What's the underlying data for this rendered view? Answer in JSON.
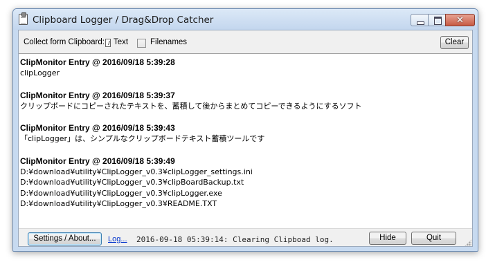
{
  "window": {
    "title": "Clipboard Logger / Drag&Drop Catcher",
    "controls": {
      "close_glyph": "✕"
    }
  },
  "toolbar": {
    "collect_label": "Collect form Clipboard:",
    "option_text_label": "Text",
    "option_filenames_label": "Filenames",
    "option_filenames_checked": false,
    "clear_label": "Clear"
  },
  "log": {
    "entries": [
      {
        "header": "ClipMonitor Entry @ 2016/09/18 5:39:28",
        "lines": [
          "clipLogger"
        ]
      },
      {
        "header": "ClipMonitor Entry @ 2016/09/18 5:39:37",
        "lines": [
          "クリップボードにコピーされたテキストを、蓄積して後からまとめてコピーできるようにするソフト"
        ]
      },
      {
        "header": "ClipMonitor Entry @ 2016/09/18 5:39:43",
        "lines": [
          "「clipLogger」は、シンプルなクリップボードテキスト蓄積ツールです"
        ]
      },
      {
        "header": "ClipMonitor Entry @ 2016/09/18 5:39:49",
        "lines": [
          "D:¥download¥utility¥ClipLogger_v0.3¥clipLogger_settings.ini",
          "D:¥download¥utility¥ClipLogger_v0.3¥clipBoardBackup.txt",
          "D:¥download¥utility¥ClipLogger_v0.3¥clipLogger.exe",
          "D:¥download¥utility¥ClipLogger_v0.3¥README.TXT"
        ]
      }
    ]
  },
  "statusbar": {
    "settings_label": "Settings / About...",
    "log_link": "Log...",
    "status_text": "2016-09-18 05:39:14: Clearing Clipboad log.",
    "hide_label": "Hide",
    "quit_label": "Quit"
  }
}
